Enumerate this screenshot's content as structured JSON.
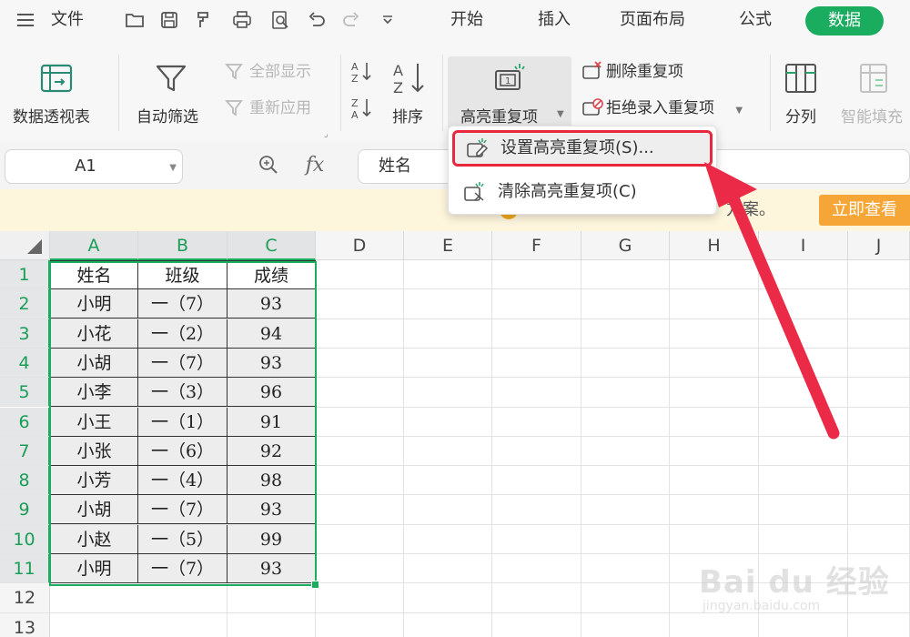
{
  "menubar": {
    "file_label": "文件",
    "tabs": [
      "开始",
      "插入",
      "页面布局",
      "公式",
      "数据"
    ],
    "active_tab": "数据",
    "accent_color": "#1aad5f"
  },
  "ribbon": {
    "pivot_label": "数据透视表",
    "autofilter_label": "自动筛选",
    "show_all_label": "全部显示",
    "reapply_label": "重新应用",
    "sort_label": "排序",
    "highlight_dup_label": "高亮重复项",
    "delete_dup_label": "删除重复项",
    "reject_dup_label": "拒绝录入重复项",
    "split_label": "分列",
    "smart_fill_label": "智能填充"
  },
  "formula_bar": {
    "cell_ref": "A1",
    "fx_label": "fx",
    "value": "姓名"
  },
  "notice": {
    "text": "方案。",
    "button_label": "立即查看"
  },
  "dropdown": {
    "items": [
      "设置高亮重复项(S)...",
      "清除高亮重复项(C)"
    ],
    "highlight_color": "#e8283c"
  },
  "sheet": {
    "columns": [
      "A",
      "B",
      "C",
      "D",
      "E",
      "F",
      "G",
      "H",
      "I",
      "J"
    ],
    "row_numbers": [
      "1",
      "2",
      "3",
      "4",
      "5",
      "6",
      "7",
      "8",
      "9",
      "10",
      "11",
      "12",
      "13"
    ],
    "header": [
      "姓名",
      "班级",
      "成绩"
    ],
    "rows": [
      [
        "小明",
        "一（7）",
        "93"
      ],
      [
        "小花",
        "一（2）",
        "94"
      ],
      [
        "小胡",
        "一（7）",
        "93"
      ],
      [
        "小李",
        "一（3）",
        "96"
      ],
      [
        "小王",
        "一（1）",
        "91"
      ],
      [
        "小张",
        "一（6）",
        "92"
      ],
      [
        "小芳",
        "一（4）",
        "98"
      ],
      [
        "小胡",
        "一（7）",
        "93"
      ],
      [
        "小赵",
        "一（5）",
        "99"
      ],
      [
        "小明",
        "一（7）",
        "93"
      ]
    ]
  },
  "watermark": {
    "brand": "Bai du 经验",
    "url": "jingyan.baidu.com"
  }
}
